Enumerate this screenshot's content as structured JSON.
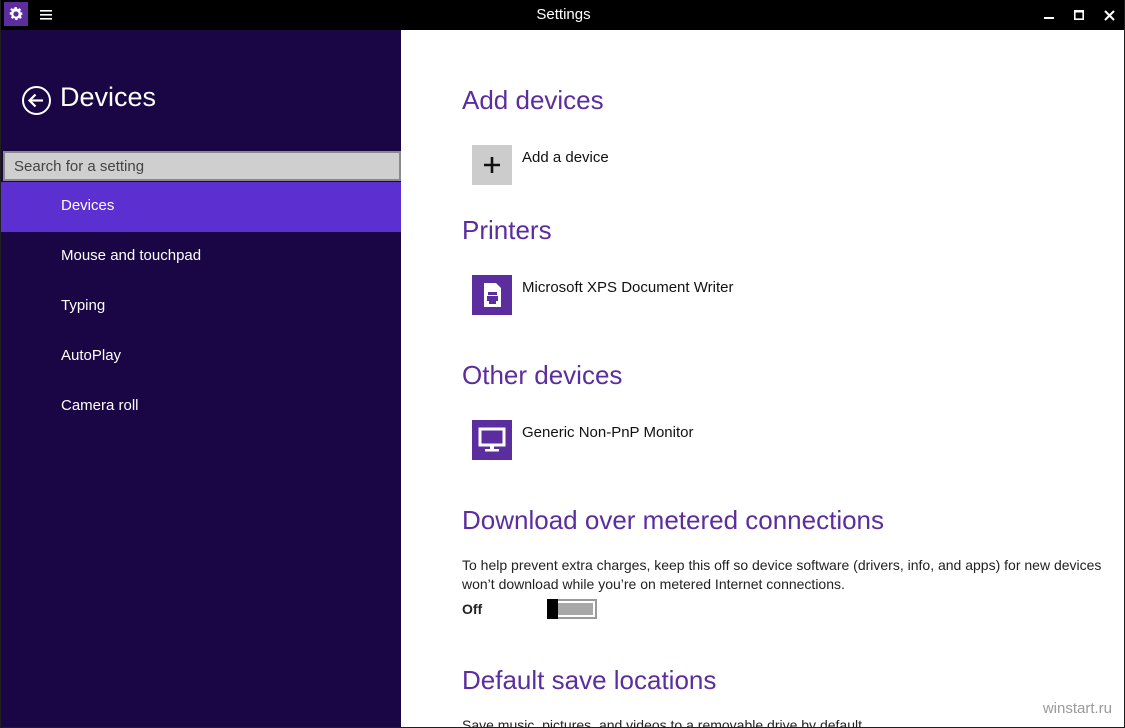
{
  "window": {
    "title": "Settings"
  },
  "titlebar": {
    "app_icon": "gear-icon",
    "menu_icon": "hamburger-icon",
    "minimize_icon": "minimize-icon",
    "maximize_icon": "maximize-icon",
    "close_icon": "close-icon"
  },
  "sidebar": {
    "title": "Devices",
    "back_icon": "back-arrow-icon",
    "search": {
      "placeholder": "Search for a setting",
      "value": ""
    },
    "items": [
      {
        "label": "Devices",
        "active": true
      },
      {
        "label": "Mouse and touchpad",
        "active": false
      },
      {
        "label": "Typing",
        "active": false
      },
      {
        "label": "AutoPlay",
        "active": false
      },
      {
        "label": "Camera roll",
        "active": false
      }
    ]
  },
  "main": {
    "add_devices": {
      "title": "Add devices",
      "action_label": "Add a device",
      "icon": "plus-icon"
    },
    "printers": {
      "title": "Printers",
      "devices": [
        {
          "label": "Microsoft XPS Document Writer",
          "icon": "printer-icon"
        }
      ]
    },
    "other_devices": {
      "title": "Other devices",
      "devices": [
        {
          "label": "Generic Non-PnP Monitor",
          "icon": "monitor-icon"
        }
      ]
    },
    "metered": {
      "title": "Download over metered connections",
      "description": "To help prevent extra charges, keep this off so device software (drivers, info, and apps) for new devices won’t download while you’re on metered Internet connections.",
      "toggle_label": "Off",
      "toggle_on": false
    },
    "save_locations": {
      "title": "Default save locations",
      "description": "Save music, pictures, and videos to a removable drive by default."
    }
  },
  "watermark": "winstart.ru",
  "colors": {
    "accent": "#5b2d9e",
    "sidebar_bg": "#1a0645",
    "nav_active": "#5b2fd0",
    "titlebar_bg": "#000000"
  }
}
